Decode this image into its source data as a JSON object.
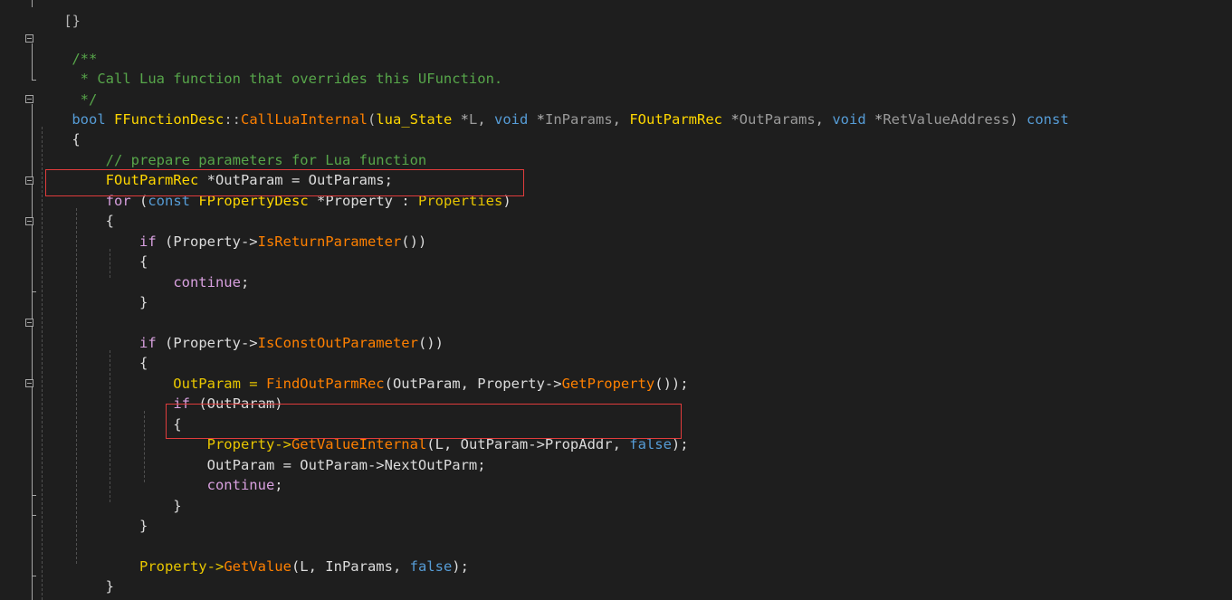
{
  "editor": {
    "colors": {
      "background": "#1e1e1e",
      "highlight_box": "#e03c3c",
      "keyword": "#569cd6",
      "control": "#d8a0df",
      "type": "#ffd700",
      "function": "#ff8000",
      "comment": "#57a64a"
    },
    "lines": {
      "l0": {
        "t1": "[}"
      },
      "l1": {
        "t1": "/**"
      },
      "l2": {
        "t1": " * Call Lua function that overrides this UFunction."
      },
      "l3": {
        "t1": " */"
      },
      "l4": {
        "t1": "bool",
        "t2": " ",
        "t3": "FFunctionDesc",
        "t4": "::",
        "t5": "CallLuaInternal",
        "t6": "(",
        "t7": "lua_State",
        "t8": " *",
        "t9": "L",
        "t10": ", ",
        "t11": "void",
        "t12": " *",
        "t13": "InParams",
        "t14": ", ",
        "t15": "FOutParmRec",
        "t16": " *",
        "t17": "OutParams",
        "t18": ", ",
        "t19": "void",
        "t20": " *",
        "t21": "RetValueAddress",
        "t22": ") ",
        "t23": "const"
      },
      "l5": {
        "t1": "{"
      },
      "l6": {
        "t1": "    // prepare parameters for Lua function"
      },
      "l7": {
        "t1": "    ",
        "t2": "FOutParmRec",
        "t3": " *OutParam = OutParams;"
      },
      "l8": {
        "t1": "    ",
        "t2": "for",
        "t3": " (",
        "t4": "const",
        "t5": " ",
        "t6": "FPropertyDesc",
        "t7": " *Property : ",
        "t8": "Properties",
        "t9": ")"
      },
      "l9": {
        "t1": "    {"
      },
      "l10": {
        "t1": "        ",
        "t2": "if",
        "t3": " (Property->",
        "t4": "IsReturnParameter",
        "t5": "())"
      },
      "l11": {
        "t1": "        {"
      },
      "l12": {
        "t1": "            ",
        "t2": "continue",
        "t3": ";"
      },
      "l13": {
        "t1": "        }"
      },
      "l14": {
        "t1": ""
      },
      "l15": {
        "t1": "        ",
        "t2": "if",
        "t3": " (Property->",
        "t4": "IsConstOutParameter",
        "t5": "())"
      },
      "l16": {
        "t1": "        {"
      },
      "l17": {
        "t1": "            OutParam = ",
        "t2": "FindOutParmRec",
        "t3": "(OutParam, Property->",
        "t4": "GetProperty",
        "t5": "());"
      },
      "l18": {
        "t1": "            ",
        "t2": "if",
        "t3": " (OutParam)"
      },
      "l19": {
        "t1": "            {"
      },
      "l20": {
        "t1": "                Property->",
        "t2": "GetValueInternal",
        "t3": "(L, OutParam->PropAddr, ",
        "t4": "false",
        "t5": ");"
      },
      "l21": {
        "t1": "                OutParam = OutParam->NextOutParm;"
      },
      "l22": {
        "t1": "                ",
        "t2": "continue",
        "t3": ";"
      },
      "l23": {
        "t1": "            }"
      },
      "l24": {
        "t1": "        }"
      },
      "l25": {
        "t1": ""
      },
      "l26": {
        "t1": "        Property->",
        "t2": "GetValue",
        "t3": "(L, InParams, ",
        "t4": "false",
        "t5": ");"
      },
      "l27": {
        "t1": "    }"
      }
    }
  }
}
